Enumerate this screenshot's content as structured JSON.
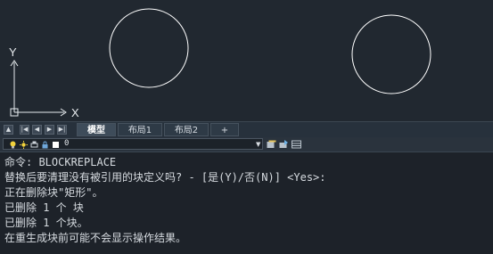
{
  "canvas": {
    "ucs_x_label": "X",
    "ucs_y_label": "Y",
    "circles": [
      {
        "name": "circle-left"
      },
      {
        "name": "circle-right"
      }
    ],
    "colors": {
      "background": "#212830",
      "geometry": "#ffffff"
    }
  },
  "tabs": {
    "items": [
      {
        "label": "模型",
        "active": true
      },
      {
        "label": "布局1",
        "active": false
      },
      {
        "label": "布局2",
        "active": false
      },
      {
        "label": "+",
        "active": false
      }
    ]
  },
  "layer": {
    "current": "0",
    "icons": [
      "lightbulb-icon",
      "sun-icon",
      "lock-icon",
      "color-swatch-icon"
    ]
  },
  "console": {
    "lines": [
      "命令: BLOCKREPLACE",
      "替换后要清理没有被引用的块定义吗? - [是(Y)/否(N)] <Yes>:",
      "正在删除块\"矩形\"。",
      "已删除 1 个 块",
      "已删除 1 个块。",
      "在重生成块前可能不会显示操作结果。"
    ]
  }
}
